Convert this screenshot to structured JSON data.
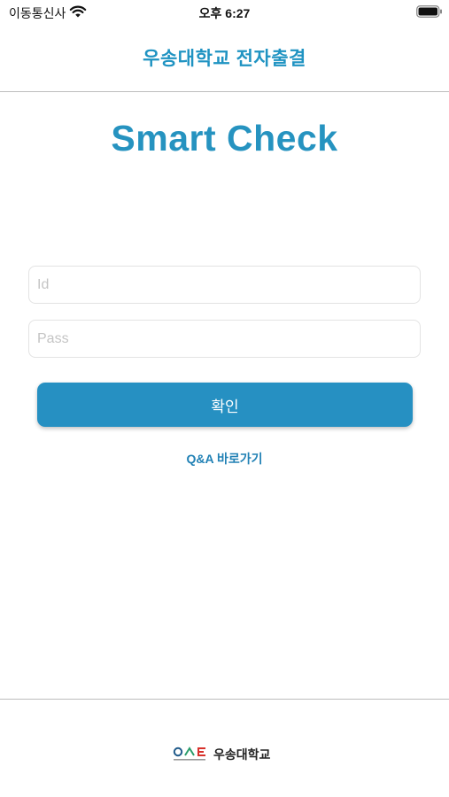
{
  "status_bar": {
    "carrier": "이동통신사",
    "time": "오후 6:27",
    "wifi_icon": "wifi-icon",
    "battery_icon": "battery-icon"
  },
  "header": {
    "title": "우송대학교 전자출결"
  },
  "main": {
    "app_title": "Smart Check",
    "id_placeholder": "Id",
    "id_value": "",
    "pass_placeholder": "Pass",
    "pass_value": "",
    "confirm_label": "확인",
    "qa_link": "Q&A 바로가기"
  },
  "footer": {
    "logo_text": "우송대학교",
    "logo_mark_text": "WOOSONG UNIVERSITY"
  },
  "colors": {
    "accent": "#2690c2",
    "title": "#1f93c2"
  }
}
